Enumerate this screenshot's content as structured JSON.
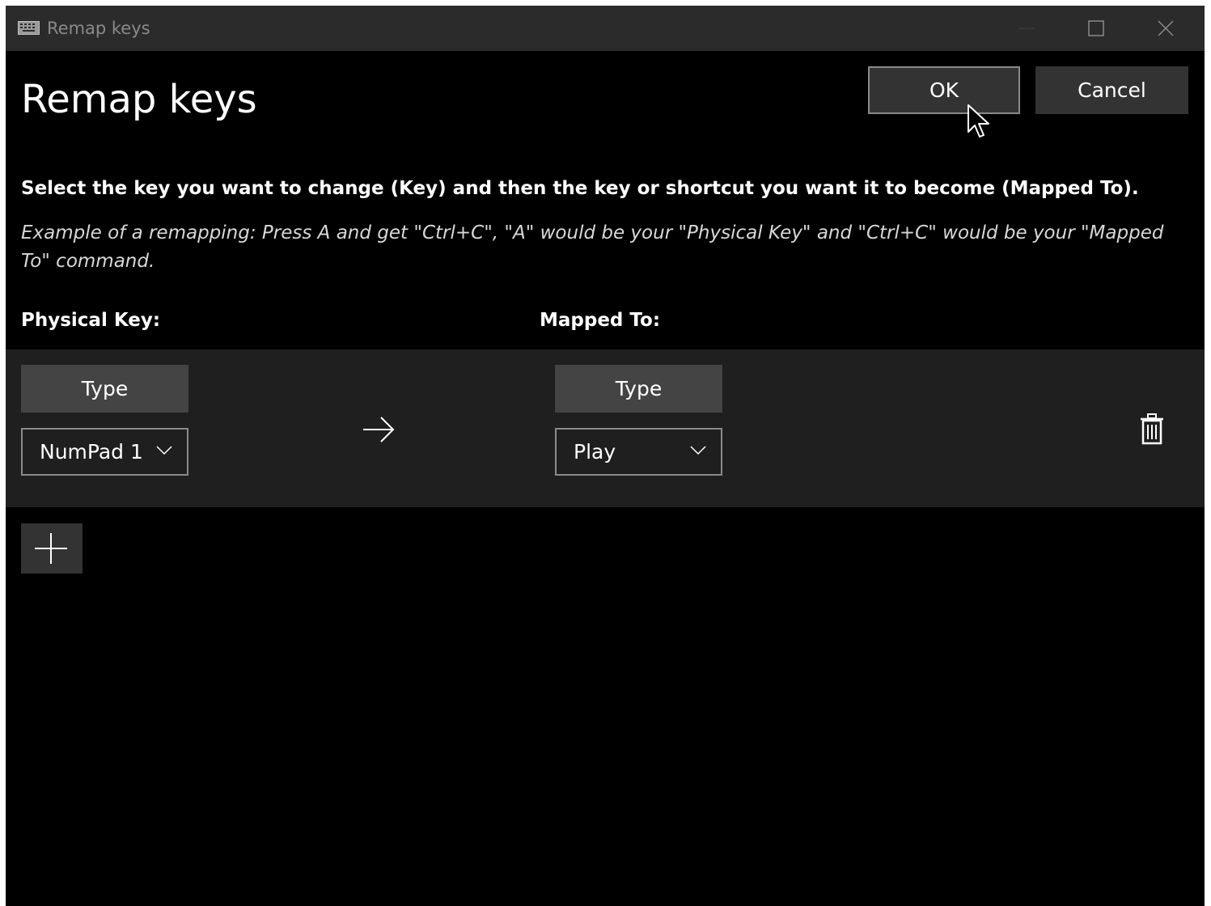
{
  "window": {
    "title": "Remap keys",
    "icon": "keyboard-icon",
    "controls": [
      "minimize-icon",
      "maximize-icon",
      "close-icon"
    ]
  },
  "header": {
    "title": "Remap keys",
    "ok_label": "OK",
    "cancel_label": "Cancel"
  },
  "instructions": "Select the key you want to change (Key) and then the key or shortcut you want it to become (Mapped To).",
  "example": "Example of a remapping: Press A and get \"Ctrl+C\", \"A\" would be your \"Physical Key\" and \"Ctrl+C\" would be your \"Mapped To\" command.",
  "columns": {
    "physical": "Physical Key:",
    "mapped": "Mapped To:"
  },
  "mappings": [
    {
      "physical": {
        "type_label": "Type",
        "value": "NumPad 1"
      },
      "mapped": {
        "type_label": "Type",
        "value": "Play"
      },
      "arrow_icon": "arrow-right-icon",
      "delete_icon": "trash-icon"
    }
  ],
  "add_icon": "plus-icon",
  "colors": {
    "background": "#000000",
    "titlebar": "#2b2b2b",
    "row": "#1f1f1f",
    "button": "#333333",
    "type_button": "#444444",
    "border": "#8a8a8a",
    "text": "#ffffff"
  }
}
